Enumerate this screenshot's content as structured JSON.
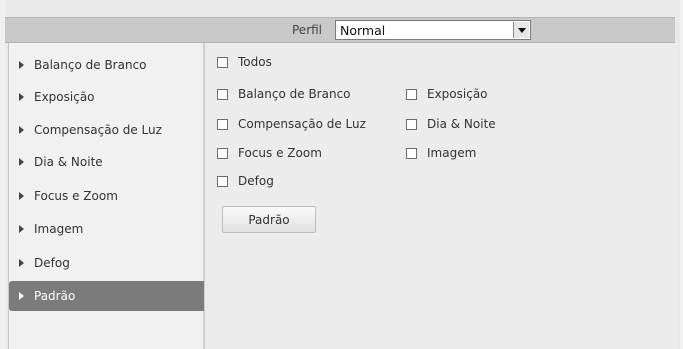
{
  "header": {
    "profile_label": "Perfil",
    "profile_value": "Normal"
  },
  "sidebar": {
    "items": [
      {
        "label": "Balanço de Branco"
      },
      {
        "label": "Exposição"
      },
      {
        "label": "Compensação de Luz"
      },
      {
        "label": "Dia & Noite"
      },
      {
        "label": "Focus e Zoom"
      },
      {
        "label": "Imagem"
      },
      {
        "label": "Defog"
      },
      {
        "label": "Padrão",
        "active": true
      }
    ]
  },
  "main": {
    "checkboxes": {
      "todos": {
        "label": "Todos",
        "checked": false
      },
      "balanco": {
        "label": "Balanço de Branco",
        "checked": false
      },
      "exposicao": {
        "label": "Exposição",
        "checked": false
      },
      "compensacao": {
        "label": "Compensação de Luz",
        "checked": false
      },
      "dia_noite": {
        "label": "Dia & Noite",
        "checked": false
      },
      "focus": {
        "label": "Focus e Zoom",
        "checked": false
      },
      "imagem": {
        "label": "Imagem",
        "checked": false
      },
      "defog": {
        "label": "Defog",
        "checked": false
      }
    },
    "default_button_label": "Padrão"
  },
  "colors": {
    "active_item_bg": "#7b7b7b",
    "topbar_bg": "#c9c9c9"
  }
}
